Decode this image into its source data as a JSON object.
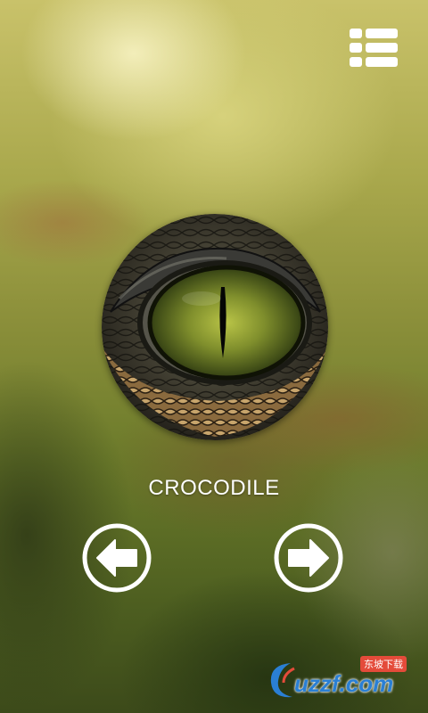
{
  "screen": {
    "animal_name": "CROCODILE"
  },
  "icons": {
    "menu": "list-menu-icon",
    "prev": "arrow-left-circle-icon",
    "next": "arrow-right-circle-icon"
  },
  "watermark": {
    "text": "uzzf.com",
    "cn_text": "东坡下载"
  },
  "colors": {
    "icon_white": "#ffffff",
    "watermark_blue": "#2a7fd4"
  }
}
